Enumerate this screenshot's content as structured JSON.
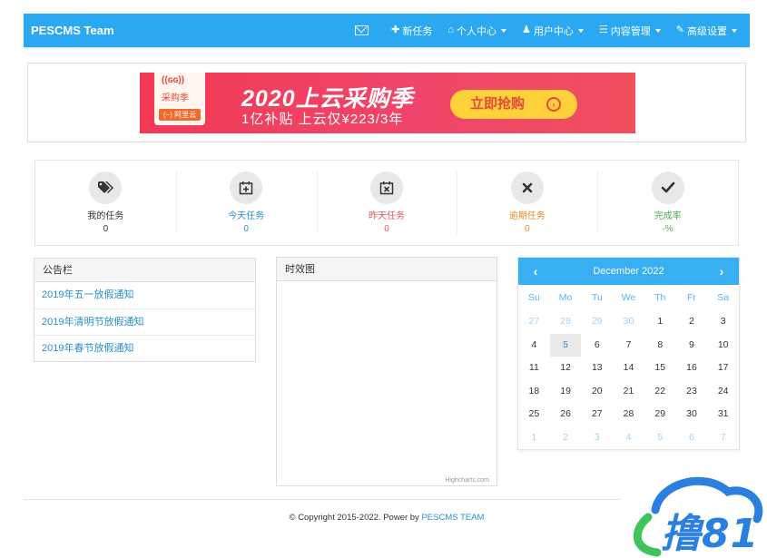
{
  "header": {
    "brand": "PESCMS Team",
    "nav": [
      {
        "label": "新任务",
        "icon": "plus-icon",
        "dropdown": false
      },
      {
        "label": "个人中心",
        "icon": "home-icon",
        "dropdown": true
      },
      {
        "label": "用户中心",
        "icon": "user-icon",
        "dropdown": true
      },
      {
        "label": "内容管理",
        "icon": "database-icon",
        "dropdown": true
      },
      {
        "label": "高级设置",
        "icon": "wrench-icon",
        "dropdown": true
      }
    ]
  },
  "banner": {
    "logo_top": "((ɢɢ))",
    "logo_mid": "采购季",
    "logo_brand": "(−) 阿里云",
    "title": "2020上云采购季",
    "subtitle": "1亿补贴 上云仅¥223/3年",
    "button": "立即抢购"
  },
  "stats": [
    {
      "label": "我的任务",
      "value": "0",
      "icon": "tags-icon",
      "color": "dark"
    },
    {
      "label": "今天任务",
      "value": "0",
      "icon": "calendar-plus-icon",
      "color": "blue"
    },
    {
      "label": "昨天任务",
      "value": "0",
      "icon": "calendar-times-icon",
      "color": "red"
    },
    {
      "label": "逾期任务",
      "value": "0",
      "icon": "times-icon",
      "color": "orange"
    },
    {
      "label": "完成率",
      "value": "-%",
      "icon": "check-icon",
      "color": "green"
    }
  ],
  "notice": {
    "title": "公告栏",
    "items": [
      "2019年五一放假通知",
      "2019年清明节放假通知",
      "2019年春节放假通知"
    ]
  },
  "chart_panel": {
    "title": "时效图",
    "credit": "Highcharts.com"
  },
  "calendar": {
    "month": "December 2022",
    "weekdays": [
      "Su",
      "Mo",
      "Tu",
      "We",
      "Th",
      "Fr",
      "Sa"
    ],
    "weeks": [
      [
        "27",
        "28",
        "29",
        "30",
        "1",
        "2",
        "3"
      ],
      [
        "4",
        "5",
        "6",
        "7",
        "8",
        "9",
        "10"
      ],
      [
        "11",
        "12",
        "13",
        "14",
        "15",
        "16",
        "17"
      ],
      [
        "18",
        "19",
        "20",
        "21",
        "22",
        "23",
        "24"
      ],
      [
        "25",
        "26",
        "27",
        "28",
        "29",
        "30",
        "31"
      ],
      [
        "1",
        "2",
        "3",
        "4",
        "5",
        "6",
        "7"
      ]
    ],
    "today": "5"
  },
  "footer": {
    "text": "© Copyright 2015-2022. Power by",
    "link": "PESCMS TEAM"
  },
  "watermark": "撸81"
}
